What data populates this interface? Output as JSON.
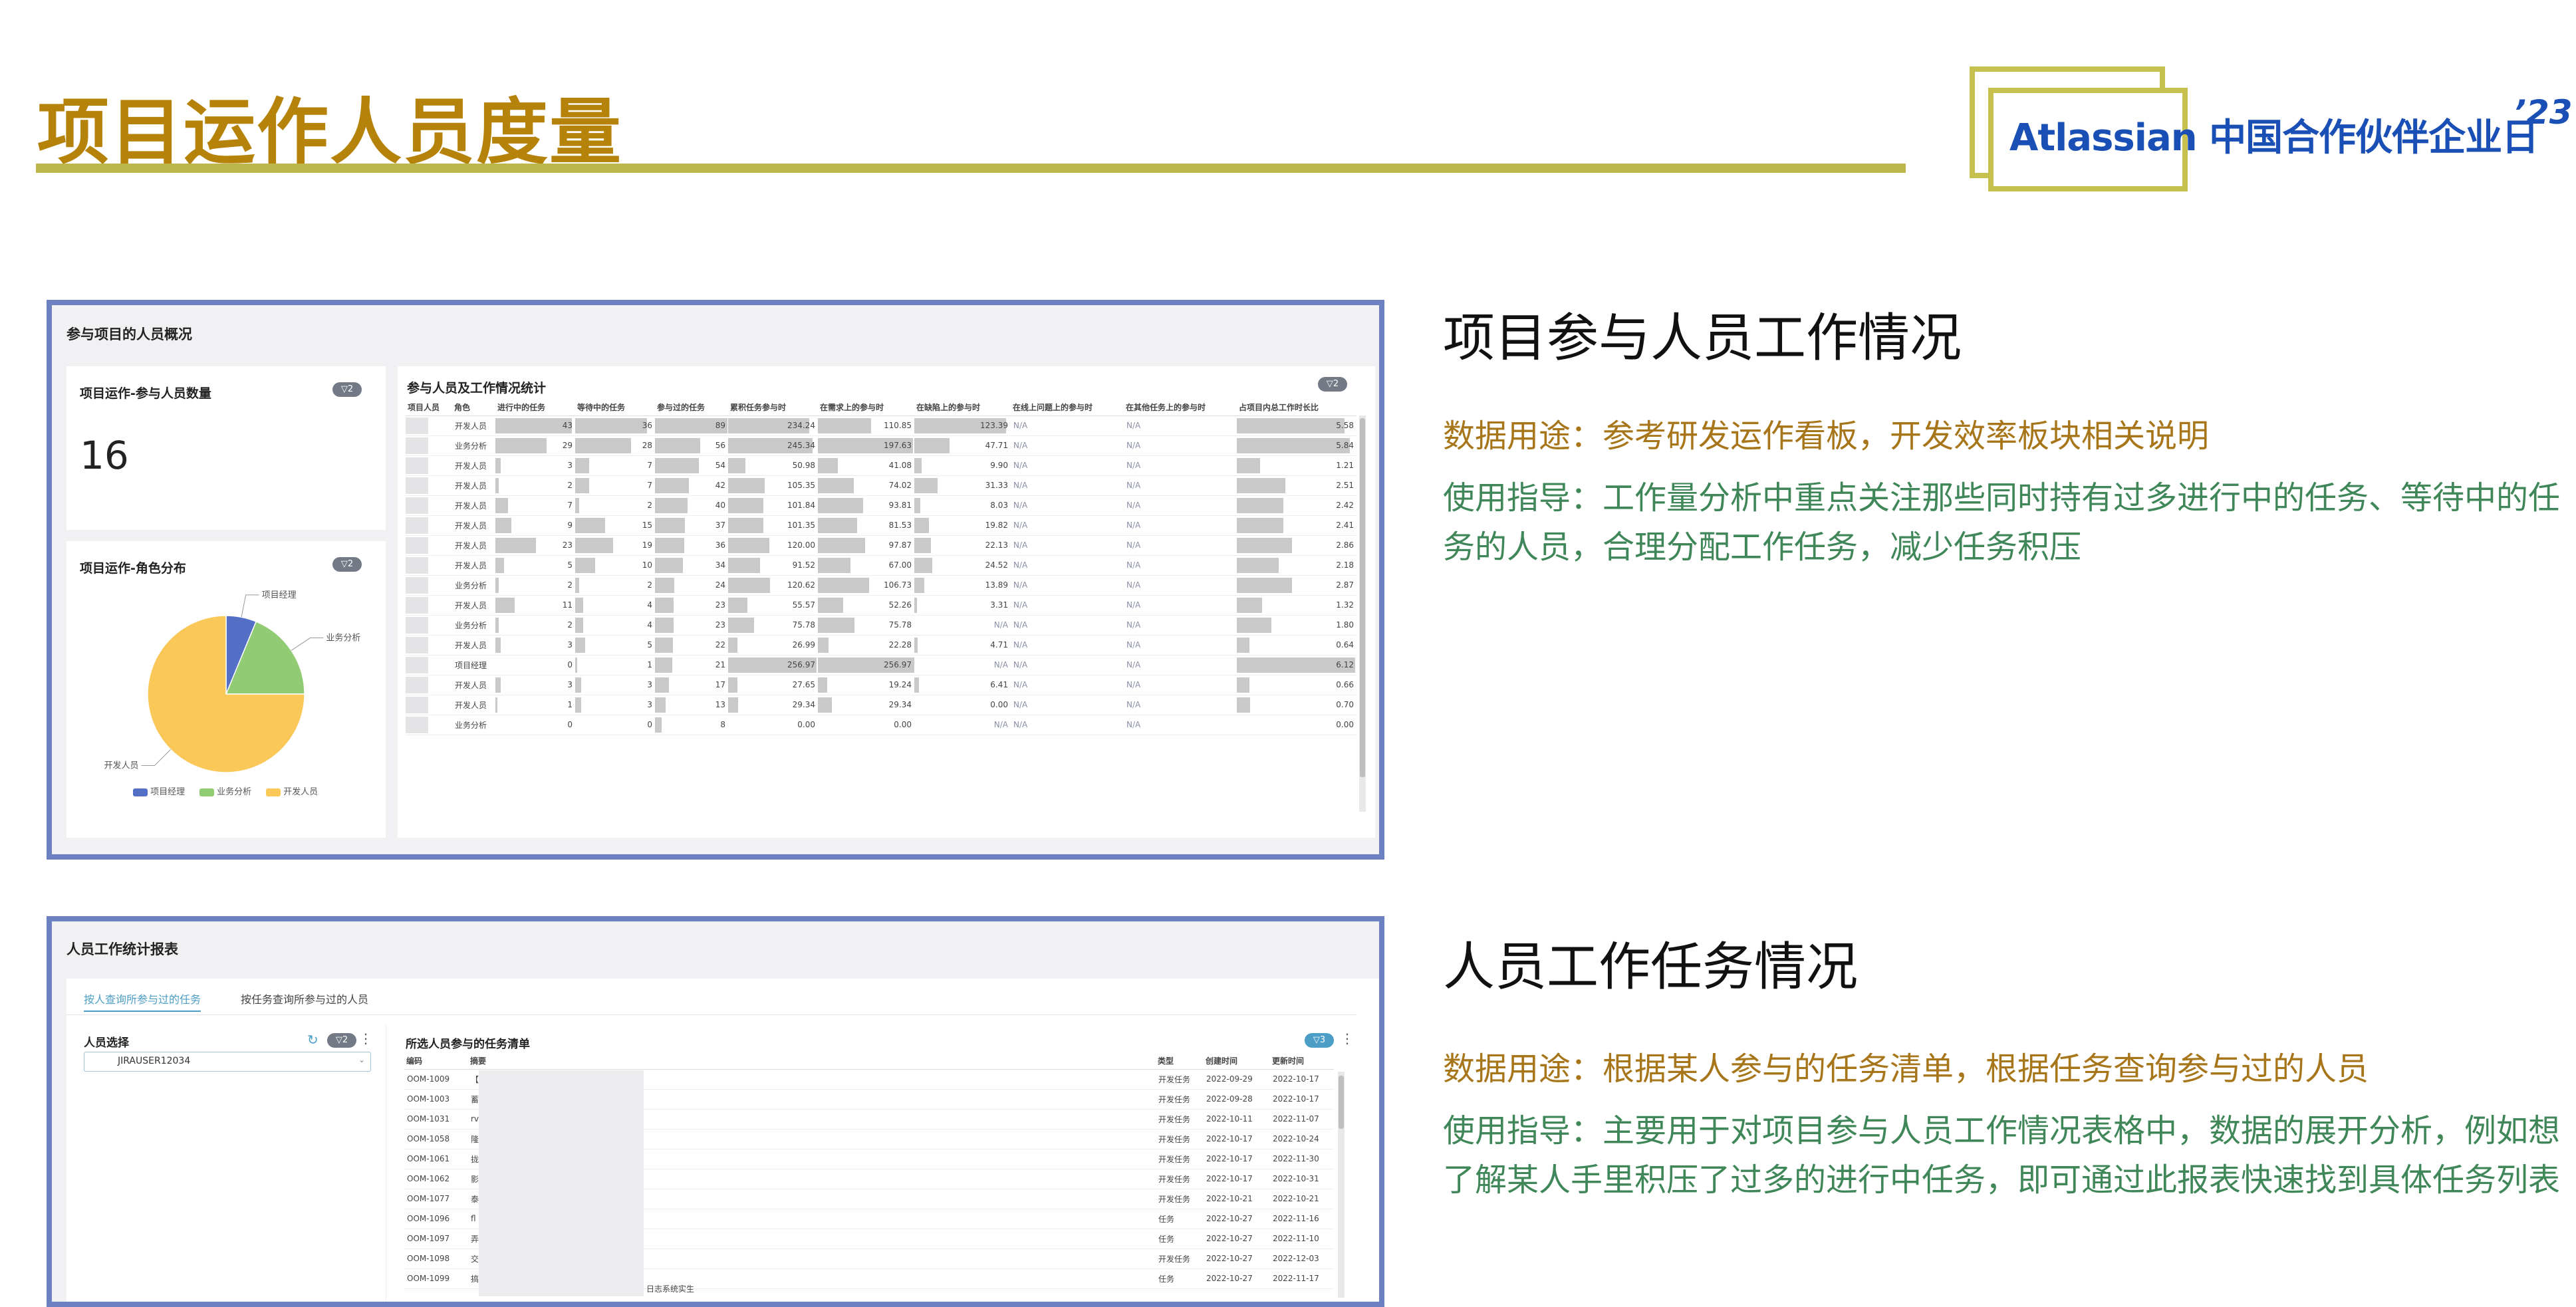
{
  "page_title": "项目运作人员度量",
  "logo": {
    "text": "Atlassian 中国合作伙伴企业日",
    "year": "’23"
  },
  "panel1": {
    "header": "参与项目的人员概况",
    "kpi": {
      "title": "项目运作-参与人员数量",
      "filter": "▽2",
      "value": "16"
    },
    "pie": {
      "title": "项目运作-角色分布",
      "filter": "▽2",
      "slices": [
        {
          "label": "项目经理",
          "value": 1,
          "color": "#5470c6"
        },
        {
          "label": "业务分析",
          "value": 3,
          "color": "#91cc75"
        },
        {
          "label": "开发人员",
          "value": 12,
          "color": "#fac858"
        }
      ]
    },
    "table": {
      "title": "参与人员及工作情况统计",
      "filter": "▽2",
      "columns": [
        "项目人员",
        "角色",
        "进行中的任务",
        "等待中的任务",
        "参与过的任务",
        "累积任务参与时",
        "在需求上的参与时",
        "在缺陷上的参与时",
        "在线上问题上的参与时",
        "在其他任务上的参与时",
        "占项目内总工作时长比"
      ],
      "rows": [
        [
          "开发人员",
          "43",
          "36",
          "89",
          "234.24",
          "110.85",
          "123.39",
          "N/A",
          "N/A",
          "5.58"
        ],
        [
          "业务分析",
          "29",
          "28",
          "56",
          "245.34",
          "197.63",
          "47.71",
          "N/A",
          "N/A",
          "5.84"
        ],
        [
          "开发人员",
          "3",
          "7",
          "54",
          "50.98",
          "41.08",
          "9.90",
          "N/A",
          "N/A",
          "1.21"
        ],
        [
          "开发人员",
          "2",
          "7",
          "42",
          "105.35",
          "74.02",
          "31.33",
          "N/A",
          "N/A",
          "2.51"
        ],
        [
          "开发人员",
          "7",
          "2",
          "40",
          "101.84",
          "93.81",
          "8.03",
          "N/A",
          "N/A",
          "2.42"
        ],
        [
          "开发人员",
          "9",
          "15",
          "37",
          "101.35",
          "81.53",
          "19.82",
          "N/A",
          "N/A",
          "2.41"
        ],
        [
          "开发人员",
          "23",
          "19",
          "36",
          "120.00",
          "97.87",
          "22.13",
          "N/A",
          "N/A",
          "2.86"
        ],
        [
          "开发人员",
          "5",
          "10",
          "34",
          "91.52",
          "67.00",
          "24.52",
          "N/A",
          "N/A",
          "2.18"
        ],
        [
          "业务分析",
          "2",
          "2",
          "24",
          "120.62",
          "106.73",
          "13.89",
          "N/A",
          "N/A",
          "2.87"
        ],
        [
          "开发人员",
          "11",
          "4",
          "23",
          "55.57",
          "52.26",
          "3.31",
          "N/A",
          "N/A",
          "1.32"
        ],
        [
          "业务分析",
          "2",
          "4",
          "23",
          "75.78",
          "75.78",
          "N/A",
          "N/A",
          "N/A",
          "1.80"
        ],
        [
          "开发人员",
          "3",
          "5",
          "22",
          "26.99",
          "22.28",
          "4.71",
          "N/A",
          "N/A",
          "0.64"
        ],
        [
          "项目经理",
          "0",
          "1",
          "21",
          "256.97",
          "256.97",
          "N/A",
          "N/A",
          "N/A",
          "6.12"
        ],
        [
          "开发人员",
          "3",
          "3",
          "17",
          "27.65",
          "19.24",
          "6.41",
          "N/A",
          "N/A",
          "0.66"
        ],
        [
          "开发人员",
          "1",
          "3",
          "13",
          "29.34",
          "29.34",
          "0.00",
          "N/A",
          "N/A",
          "0.70"
        ],
        [
          "业务分析",
          "0",
          "0",
          "8",
          "0.00",
          "0.00",
          "N/A",
          "N/A",
          "N/A",
          "0.00"
        ]
      ]
    }
  },
  "panel2": {
    "header": "人员工作统计报表",
    "tabs": [
      "按人查询所参与过的任务",
      "按任务查询所参与过的人员"
    ],
    "person_select": {
      "label": "人员选择",
      "filter": "▽2",
      "value": "JIRAUSER12034"
    },
    "task_list": {
      "title": "所选人员参与的任务清单",
      "filter": "▽3",
      "columns": [
        "编码",
        "摘要",
        "类型",
        "创建时间",
        "更新时间"
      ],
      "rows": [
        [
          "OOM-1009",
          "【",
          "开发任务",
          "2022-09-29",
          "2022-10-17"
        ],
        [
          "OOM-1003",
          "蓄",
          "开发任务",
          "2022-09-28",
          "2022-10-17"
        ],
        [
          "OOM-1031",
          "rv",
          "开发任务",
          "2022-10-11",
          "2022-11-07"
        ],
        [
          "OOM-1058",
          "隆",
          "开发任务",
          "2022-10-17",
          "2022-10-24"
        ],
        [
          "OOM-1061",
          "拢",
          "开发任务",
          "2022-10-17",
          "2022-11-30"
        ],
        [
          "OOM-1062",
          "影",
          "开发任务",
          "2022-10-17",
          "2022-10-31"
        ],
        [
          "OOM-1077",
          "泰",
          "开发任务",
          "2022-10-21",
          "2022-10-21"
        ],
        [
          "OOM-1096",
          "fl",
          "任务",
          "2022-10-27",
          "2022-11-16"
        ],
        [
          "OOM-1097",
          "弄",
          "任务",
          "2022-10-27",
          "2022-11-10"
        ],
        [
          "OOM-1098",
          "交",
          "开发任务",
          "2022-10-27",
          "2022-12-03"
        ],
        [
          "OOM-1099",
          "搞",
          "任务",
          "2022-10-27",
          "2022-11-17"
        ]
      ],
      "note": "日志系统实生"
    }
  },
  "section1": {
    "heading": "项目参与人员工作情况",
    "usage": "数据用途：参考研发运作看板，开发效率板块相关说明",
    "guide": "使用指导：工作量分析中重点关注那些同时持有过多进行中的任务、等待中的任务的人员，合理分配工作任务，减少任务积压"
  },
  "section2": {
    "heading": "人员工作任务情况",
    "usage": "数据用途：根据某人参与的任务清单，根据任务查询参与过的人员",
    "guide": "使用指导：主要用于对项目参与人员工作情况表格中，数据的展开分析，例如想了解某人手里积压了过多的进行中任务，即可通过此报表快速找到具体任务列表"
  }
}
